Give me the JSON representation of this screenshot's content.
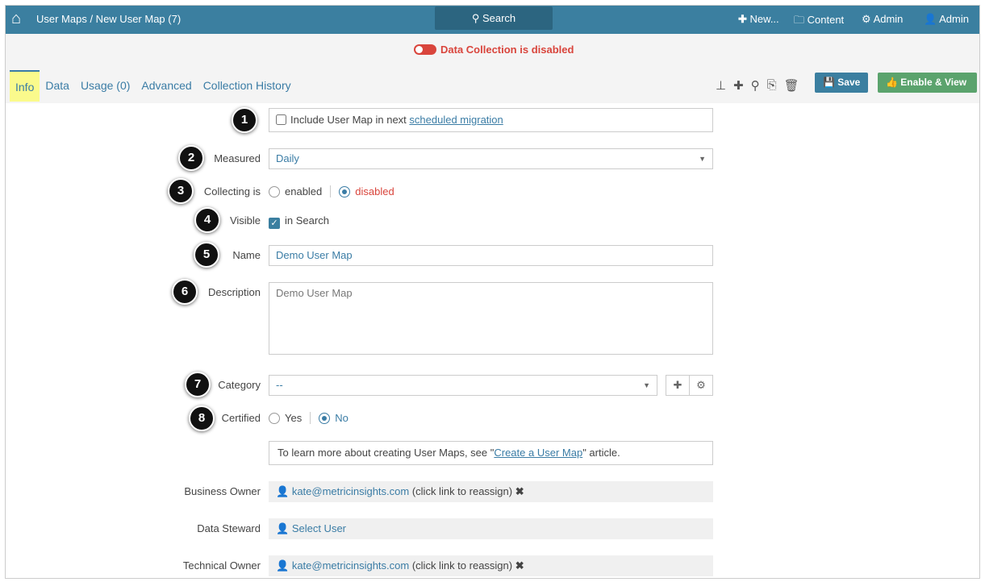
{
  "header": {
    "breadcrumb": "User Maps / New User Map (7)",
    "search": "Search",
    "new": "New...",
    "content": "Content",
    "admin1": "Admin",
    "admin2": "Admin"
  },
  "status": {
    "text": "Data Collection is disabled"
  },
  "tabs": [
    "Info",
    "Data",
    "Usage (0)",
    "Advanced",
    "Collection History"
  ],
  "toolbar": {
    "save": "Save",
    "enable_view": "Enable & View"
  },
  "form": {
    "migration": {
      "text": "Include User Map in next ",
      "link": "scheduled migration",
      "checked": false
    },
    "measured": {
      "label": "Measured",
      "value": "Daily"
    },
    "collecting": {
      "label": "Collecting is",
      "opt1": "enabled",
      "opt2": "disabled",
      "selected": "disabled"
    },
    "visible": {
      "label": "Visible",
      "text": "in Search",
      "checked": true
    },
    "name": {
      "label": "Name",
      "value": "Demo User Map"
    },
    "description": {
      "label": "Description",
      "value": "Demo User Map"
    },
    "category": {
      "label": "Category",
      "value": "--"
    },
    "certified": {
      "label": "Certified",
      "opt1": "Yes",
      "opt2": "No",
      "selected": "No"
    },
    "info": {
      "pre": "To learn more about creating User Maps, see \"",
      "link": "Create a User Map",
      "post": "\" article."
    },
    "business_owner": {
      "label": "Business Owner",
      "user": "kate@metricinsights.com",
      "note": "(click link to reassign)"
    },
    "data_steward": {
      "label": "Data Steward",
      "user": "Select User"
    },
    "technical_owner": {
      "label": "Technical Owner",
      "user": "kate@metricinsights.com",
      "note": "(click link to reassign)"
    }
  },
  "callouts": [
    "1",
    "2",
    "3",
    "4",
    "5",
    "6",
    "7",
    "8"
  ]
}
